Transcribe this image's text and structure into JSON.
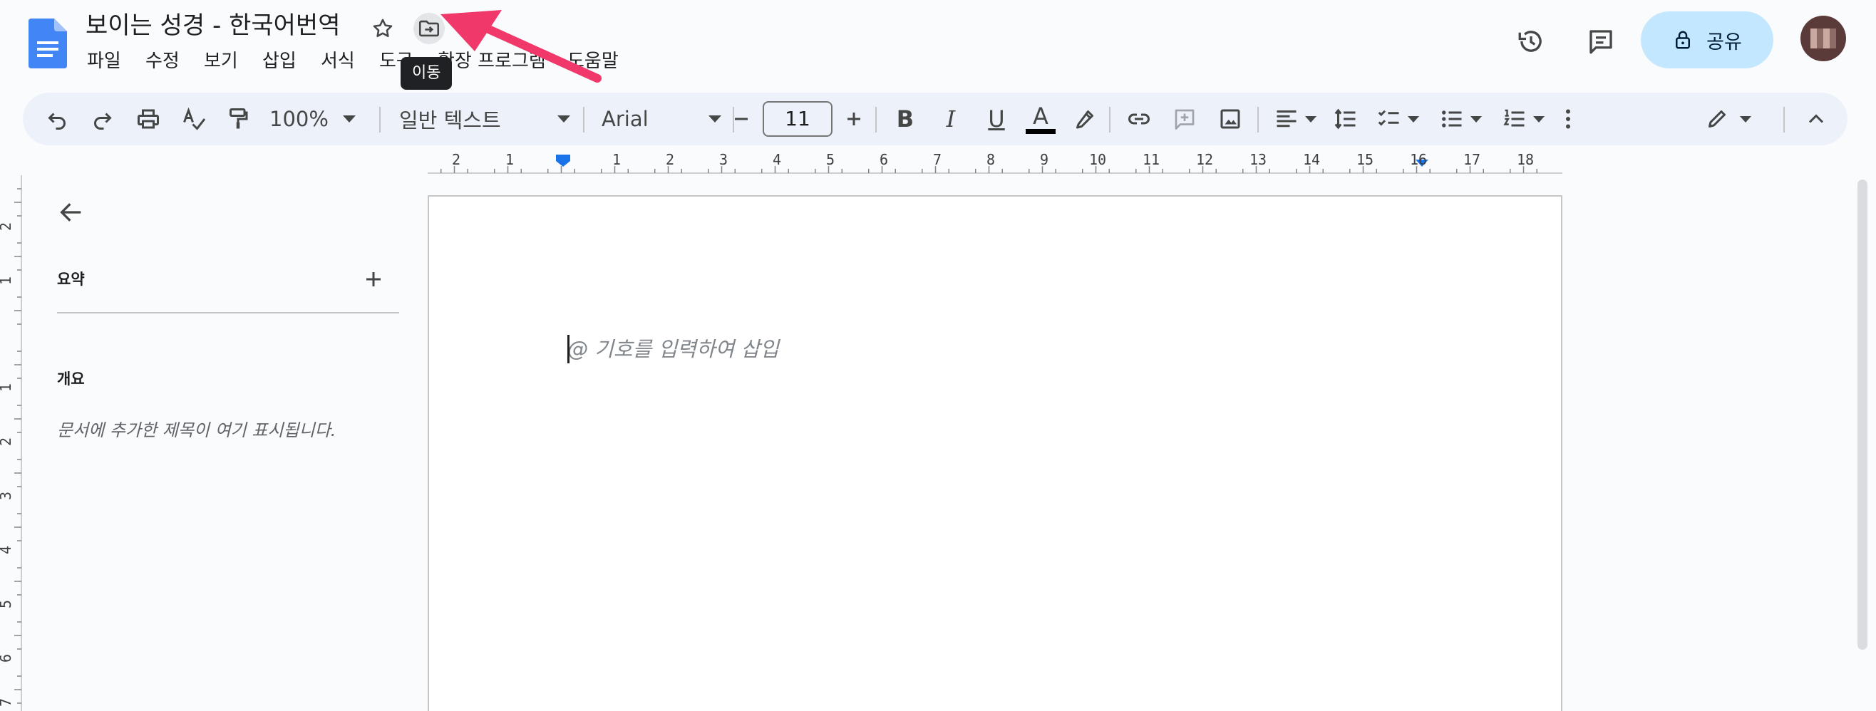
{
  "app": {
    "document_title": "보이는 성경 - 한국어번역"
  },
  "menu": {
    "items": [
      "파일",
      "수정",
      "보기",
      "삽입",
      "서식",
      "도구",
      "확장 프로그램",
      "도움말"
    ]
  },
  "tooltip": {
    "text": "이동"
  },
  "header": {
    "share_label": "공유"
  },
  "toolbar": {
    "zoom": "100%",
    "style": "일반 텍스트",
    "font": "Arial",
    "font_size": "11",
    "text_color": "#000000"
  },
  "ruler": {
    "horizontal_labels": [
      "2",
      "1",
      "1",
      "2",
      "3",
      "4",
      "5",
      "6",
      "7",
      "8",
      "9",
      "10",
      "11",
      "12",
      "13",
      "14",
      "15",
      "16",
      "17",
      "18"
    ],
    "vertical_labels": [
      "2",
      "1",
      "1",
      "2",
      "3",
      "4",
      "5",
      "6",
      "7"
    ]
  },
  "sidebar": {
    "summary_label": "요약",
    "outline_label": "개요",
    "outline_hint": "문서에 추가한 제목이 여기 표시됩니다."
  },
  "document": {
    "placeholder": "@ 기호를 입력하여 삽입"
  },
  "colors": {
    "accent": "#1a73e8",
    "share_bg": "#c2e7ff",
    "toolbar_bg": "#edf2fa",
    "annotation_arrow": "#f0386b"
  }
}
